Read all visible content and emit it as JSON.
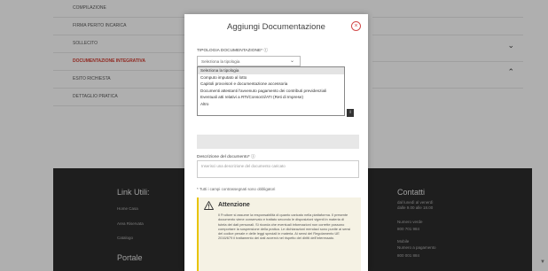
{
  "background": {
    "left_nav": [
      {
        "label": "COMPILAZIONE",
        "active": false
      },
      {
        "label": "FIRMA PERITO INCARICA",
        "active": false
      },
      {
        "label": "SOLLECITO",
        "active": false
      },
      {
        "label": "DOCUMENTAZIONE INTEGRATIVA",
        "active": true
      },
      {
        "label": "ESITO RICHIESTA",
        "active": false
      },
      {
        "label": "DETTAGLIO PRATICA",
        "active": false
      }
    ],
    "footer": {
      "useful_links_title": "Link Utili:",
      "useful_links": [
        "Home Casa",
        "Area Riservata",
        "Catalogo"
      ],
      "portal_title": "Portale",
      "contacts_title": "Contatti",
      "contacts": [
        "dal lunedì al venerdì",
        "dalle 9.00 alle 18.00",
        "Numero verde",
        "800 701 984",
        "Mobile",
        "Numero a pagamento",
        "800 001 884"
      ]
    }
  },
  "modal": {
    "title": "Aggiungi Documentazione",
    "close_icon": "close-icon",
    "tipologia_label": "TIPOLOGIA DOCUMENTAZIONE* ⓘ",
    "select_placeholder": "Seleziona la tipologia",
    "options": [
      "Seleziona la tipologia",
      "Computo imputato al lotto",
      "Capitoli provvisori e documentazione accessoria",
      "Documenti attestanti l'avvenuto pagamento dei contributi previdenziali",
      "Eventuali atti relativi a RTI/Consorzi/ATI (Reti di Imprese)",
      "Altro"
    ],
    "selected_option_index": 0,
    "descrizione_label": "Descrizione del documento* ⓘ",
    "descrizione_placeholder": "Inserisci una descrizione del documento caricato",
    "required_note": "* Tutti i campi contrassegnati sono obbligatori",
    "warning": {
      "icon": "warning-icon",
      "title": "Attenzione",
      "body": "Il Fruitore si assume la responsabilità di quanto caricato nella piattaforma. Il presente documento viene conservato e trattato secondo le disposizioni vigenti in materia di tutela dei dati personali. Si ricorda che eventuali informazioni non corrette possono comportare la sospensione della pratica. Le dichiarazioni mendaci sono punite ai sensi del codice penale e delle leggi speciali in materia. Ai sensi del Regolamento UE 2016/679 il trattamento dei dati avverrà nel rispetto dei diritti dell'interessato."
    }
  },
  "colors": {
    "accent_red": "#d24a4a",
    "warning_yellow": "#e8c400",
    "footer_bg": "#2a2a2a"
  }
}
